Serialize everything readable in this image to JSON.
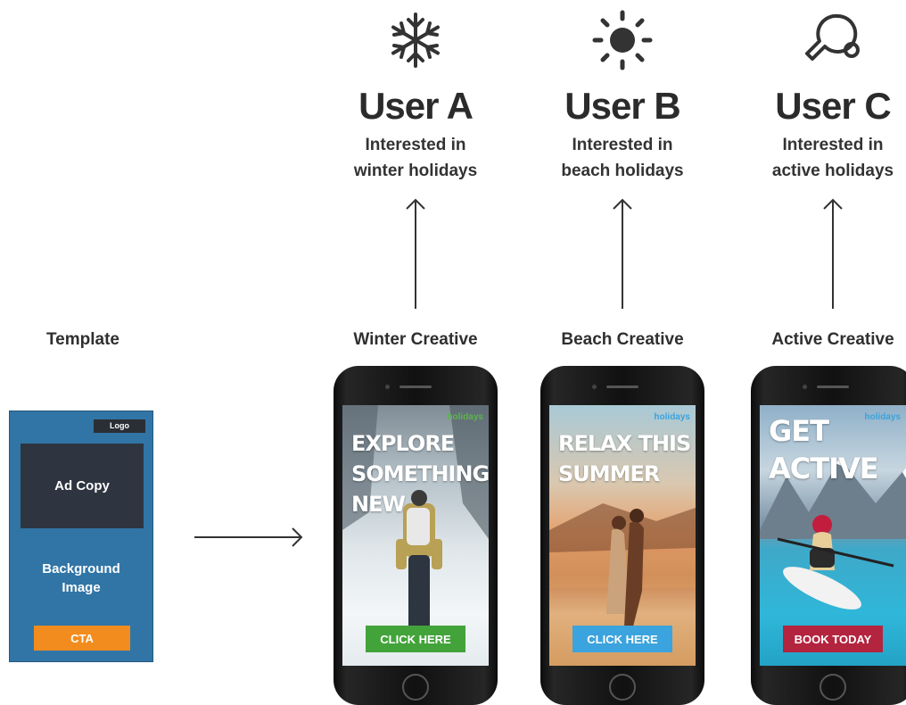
{
  "users": [
    {
      "title": "User A",
      "line1": "Interested in",
      "line2": "winter holidays",
      "icon": "snowflake-icon"
    },
    {
      "title": "User B",
      "line1": "Interested in",
      "line2": "beach holidays",
      "icon": "sun-icon"
    },
    {
      "title": "User C",
      "line1": "Interested in",
      "line2": "active holidays",
      "icon": "ping-pong-paddle-icon"
    }
  ],
  "template": {
    "label": "Template",
    "logo": "Logo",
    "ad_copy": "Ad Copy",
    "background_line1": "Background",
    "background_line2": "Image",
    "cta": "CTA"
  },
  "creatives": [
    {
      "label": "Winter Creative",
      "headline": "EXPLORE SOMETHING NEW",
      "brand": "holidays",
      "cta": "CLICK HERE",
      "cta_color": "#43a33b"
    },
    {
      "label": "Beach Creative",
      "headline": "RELAX THIS SUMMER",
      "brand": "holidays",
      "cta": "CLICK HERE",
      "cta_color": "#3ba3dd"
    },
    {
      "label": "Active Creative",
      "headline": "GET ACTIVE",
      "brand": "holidays",
      "cta": "BOOK TODAY",
      "cta_color": "#b3243f"
    }
  ]
}
